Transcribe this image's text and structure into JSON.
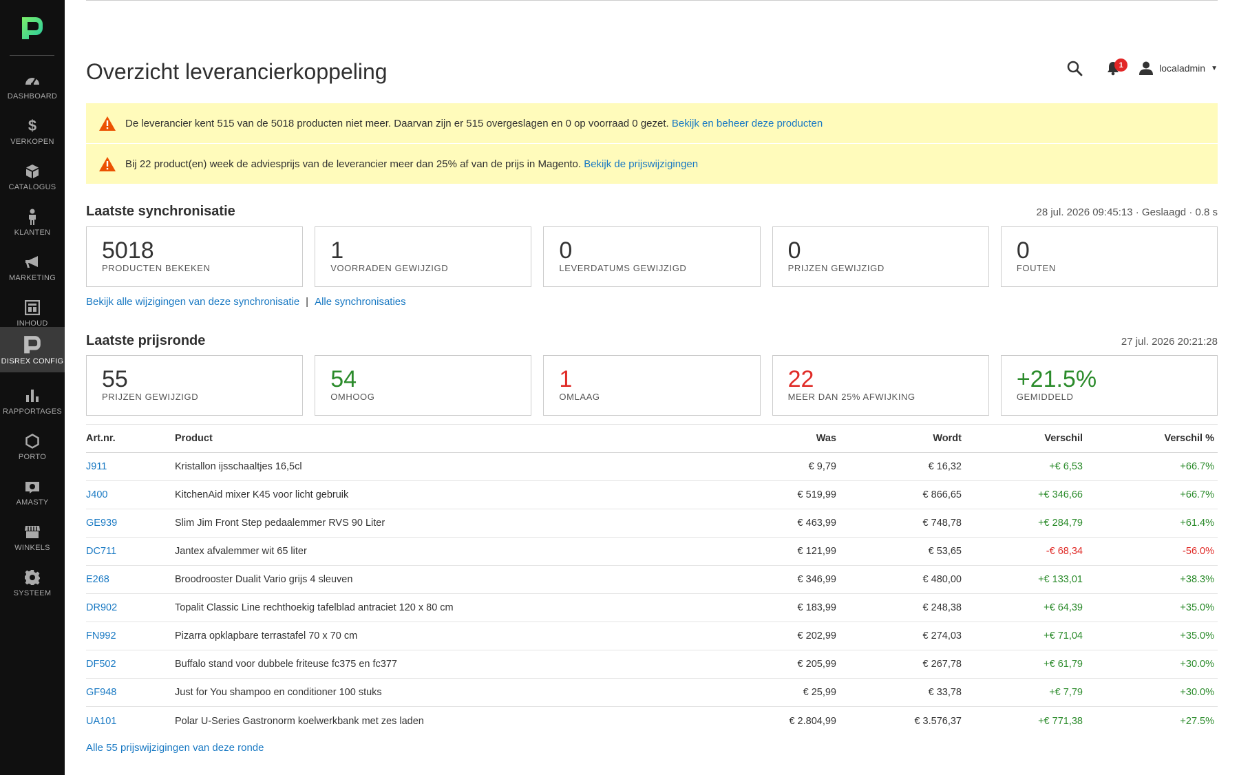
{
  "sidebar": {
    "items": [
      {
        "label": "DASHBOARD",
        "icon": "dashboard-icon"
      },
      {
        "label": "VERKOPEN",
        "icon": "dollar-icon"
      },
      {
        "label": "CATALOGUS",
        "icon": "cube-icon"
      },
      {
        "label": "KLANTEN",
        "icon": "person-icon"
      },
      {
        "label": "MARKETING",
        "icon": "megaphone-icon"
      },
      {
        "label": "INHOUD",
        "icon": "layout-icon"
      },
      {
        "label": "DISREX CONFIG",
        "icon": "disrex-icon",
        "active": true
      },
      {
        "label": "RAPPORTAGES",
        "icon": "bar-chart-icon"
      },
      {
        "label": "PORTO",
        "icon": "hexagon-icon"
      },
      {
        "label": "AMASTY",
        "icon": "amasty-icon"
      },
      {
        "label": "WINKELS",
        "icon": "store-icon"
      },
      {
        "label": "SYSTEEM",
        "icon": "gear-icon"
      }
    ]
  },
  "header": {
    "title": "Overzicht leverancierkoppeling",
    "notification_count": "1",
    "user": "localadmin"
  },
  "alerts": [
    {
      "text": "De leverancier kent 515 van de 5018 producten niet meer. Daarvan zijn er 515 overgeslagen en 0 op voorraad 0 gezet.",
      "link": "Bekijk en beheer deze producten"
    },
    {
      "text": "Bij 22 product(en) week de adviesprijs van de leverancier meer dan 25% af van de prijs in Magento.",
      "link": "Bekijk de prijswijzigingen"
    }
  ],
  "sync": {
    "title": "Laatste synchronisatie",
    "meta": "28 jul. 2026 09:45:13 · Geslaagd · 0.8 s",
    "cards": [
      {
        "value": "5018",
        "label": "PRODUCTEN BEKEKEN"
      },
      {
        "value": "1",
        "label": "VOORRADEN GEWIJZIGD"
      },
      {
        "value": "0",
        "label": "LEVERDATUMS GEWIJZIGD"
      },
      {
        "value": "0",
        "label": "PRIJZEN GEWIJZIGD"
      },
      {
        "value": "0",
        "label": "FOUTEN"
      }
    ],
    "link_changes": "Bekijk alle wijzigingen van deze synchronisatie",
    "separator": "|",
    "link_all": "Alle synchronisaties"
  },
  "price_round": {
    "title": "Laatste prijsronde",
    "meta": "27 jul. 2026 20:21:28",
    "cards": [
      {
        "value": "55",
        "label": "PRIJZEN GEWIJZIGD",
        "tone": "neutral"
      },
      {
        "value": "54",
        "label": "OMHOOG",
        "tone": "green"
      },
      {
        "value": "1",
        "label": "OMLAAG",
        "tone": "red"
      },
      {
        "value": "22",
        "label": "MEER DAN 25% AFWIJKING",
        "tone": "red"
      },
      {
        "value": "+21.5%",
        "label": "GEMIDDELD",
        "tone": "green"
      }
    ]
  },
  "table": {
    "headers": {
      "art": "Art.nr.",
      "product": "Product",
      "was": "Was",
      "wordt": "Wordt",
      "diff": "Verschil",
      "pct": "Verschil %"
    },
    "rows": [
      {
        "art": "J911",
        "product": "Kristallon ijsschaaltjes 16,5cl",
        "was": "€ 9,79",
        "wordt": "€ 16,32",
        "diff": "+€ 6,53",
        "pct": "+66.7%"
      },
      {
        "art": "J400",
        "product": "KitchenAid mixer K45 voor licht gebruik",
        "was": "€ 519,99",
        "wordt": "€ 866,65",
        "diff": "+€ 346,66",
        "pct": "+66.7%"
      },
      {
        "art": "GE939",
        "product": "Slim Jim Front Step pedaalemmer RVS 90 Liter",
        "was": "€ 463,99",
        "wordt": "€ 748,78",
        "diff": "+€ 284,79",
        "pct": "+61.4%"
      },
      {
        "art": "DC711",
        "product": "Jantex afvalemmer wit 65 liter",
        "was": "€ 121,99",
        "wordt": "€ 53,65",
        "diff": "-€ 68,34",
        "pct": "-56.0%"
      },
      {
        "art": "E268",
        "product": "Broodrooster Dualit Vario grijs 4 sleuven",
        "was": "€ 346,99",
        "wordt": "€ 480,00",
        "diff": "+€ 133,01",
        "pct": "+38.3%"
      },
      {
        "art": "DR902",
        "product": "Topalit Classic Line rechthoekig tafelblad antraciet 120 x 80 cm",
        "was": "€ 183,99",
        "wordt": "€ 248,38",
        "diff": "+€ 64,39",
        "pct": "+35.0%"
      },
      {
        "art": "FN992",
        "product": "Pizarra opklapbare terrastafel 70 x 70 cm",
        "was": "€ 202,99",
        "wordt": "€ 274,03",
        "diff": "+€ 71,04",
        "pct": "+35.0%"
      },
      {
        "art": "DF502",
        "product": "Buffalo stand voor dubbele friteuse fc375 en fc377",
        "was": "€ 205,99",
        "wordt": "€ 267,78",
        "diff": "+€ 61,79",
        "pct": "+30.0%"
      },
      {
        "art": "GF948",
        "product": "Just for You shampoo en conditioner 100 stuks",
        "was": "€ 25,99",
        "wordt": "€ 33,78",
        "diff": "+€ 7,79",
        "pct": "+30.0%"
      },
      {
        "art": "UA101",
        "product": "Polar U-Series Gastronorm koelwerkbank met zes laden",
        "was": "€ 2.804,99",
        "wordt": "€ 3.576,37",
        "diff": "+€ 771,38",
        "pct": "+27.5%"
      }
    ]
  },
  "footer_link": "Alle 55 prijswijzigingen van deze ronde",
  "colors": {
    "accent": "#1979c3",
    "positive": "#2b8b2b",
    "negative": "#e02b27",
    "alert_bg": "#fffbbb",
    "sidebar_bg": "#101010",
    "logo_green": "#3ddc84"
  }
}
